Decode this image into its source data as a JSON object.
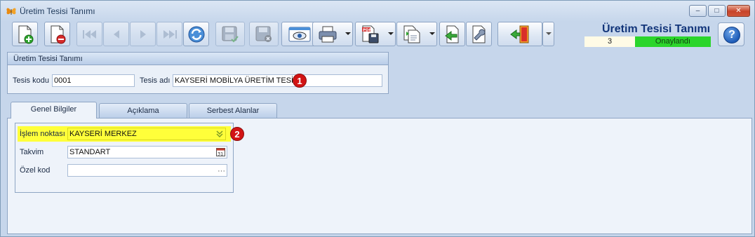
{
  "window": {
    "title": "Üretim Tesisi Tanımı",
    "controls": {
      "minimize": "–",
      "maximize": "□",
      "close": "✕"
    }
  },
  "toolbar": {
    "buttons": [
      {
        "name": "new-record-button",
        "icon": "new-document-icon"
      },
      {
        "name": "delete-record-button",
        "icon": "delete-document-icon"
      },
      {
        "name": "first-record-button",
        "icon": "first-icon",
        "disabled": true
      },
      {
        "name": "previous-record-button",
        "icon": "previous-icon",
        "disabled": true
      },
      {
        "name": "next-record-button",
        "icon": "next-icon",
        "disabled": true
      },
      {
        "name": "last-record-button",
        "icon": "last-icon",
        "disabled": true
      },
      {
        "name": "refresh-button",
        "icon": "refresh-icon"
      },
      {
        "name": "save-button",
        "icon": "save-icon",
        "disabled": true
      },
      {
        "name": "save-close-button",
        "icon": "save-cancel-icon",
        "disabled": true
      },
      {
        "name": "preview-button",
        "icon": "preview-icon"
      },
      {
        "name": "print-button",
        "icon": "printer-icon"
      },
      {
        "name": "export-pdf-button",
        "icon": "pdf-save-icon",
        "pdf_text": "PDF"
      },
      {
        "name": "copy-document-button",
        "icon": "copy-document-icon"
      },
      {
        "name": "import-button",
        "icon": "import-icon"
      },
      {
        "name": "tools-button",
        "icon": "wrench-icon"
      },
      {
        "name": "exit-button",
        "icon": "exit-door-icon"
      }
    ]
  },
  "header": {
    "title": "Üretim Tesisi Tanımı",
    "record_number": "3",
    "status": "Onaylandı",
    "status_color": "#2bd52b",
    "help_label": "?"
  },
  "facility_group": {
    "title": "Üretim Tesisi Tanımı",
    "code_label": "Tesis kodu",
    "code_value": "0001",
    "name_label": "Tesis adı",
    "name_value": "KAYSERİ MOBİLYA ÜRETİM TESİSİ",
    "badge": "1"
  },
  "tabs": [
    {
      "label": "Genel Bilgiler",
      "active": true
    },
    {
      "label": "Açıklama",
      "active": false
    },
    {
      "label": "Serbest Alanlar",
      "active": false
    }
  ],
  "general": {
    "operation_point_label": "İşlem noktası",
    "operation_point_value": "KAYSERİ MERKEZ",
    "highlight_color": "#ffff3a",
    "badge": "2",
    "calendar_label": "Takvim",
    "calendar_value": "STANDART",
    "calendar_icon_text": "31",
    "special_code_label": "Özel kod",
    "special_code_value": "",
    "ellipsis": "···"
  }
}
